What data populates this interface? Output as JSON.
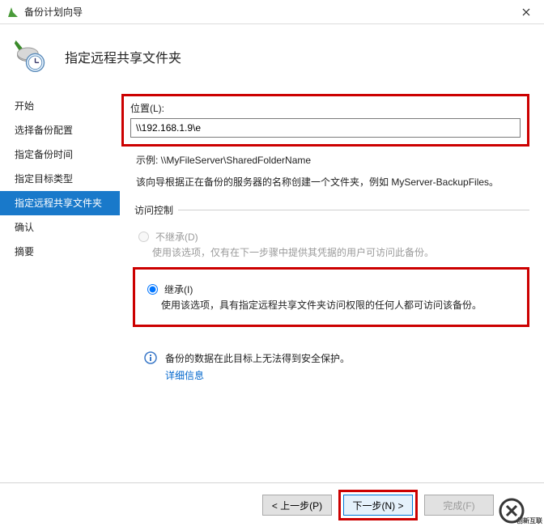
{
  "window": {
    "title": "备份计划向导"
  },
  "header": {
    "title": "指定远程共享文件夹"
  },
  "sidebar": {
    "steps": [
      {
        "label": "开始"
      },
      {
        "label": "选择备份配置"
      },
      {
        "label": "指定备份时间"
      },
      {
        "label": "指定目标类型"
      },
      {
        "label": "指定远程共享文件夹"
      },
      {
        "label": "确认"
      },
      {
        "label": "摘要"
      }
    ]
  },
  "main": {
    "location_label": "位置(L):",
    "location_value": "\\\\192.168.1.9\\e",
    "example_text": "示例: \\\\MyFileServer\\SharedFolderName",
    "folder_note": "该向导根据正在备份的服务器的名称创建一个文件夹，例如 MyServer-BackupFiles。",
    "access_legend": "访问控制",
    "radio_no_inherit": {
      "label": "不继承(D)",
      "desc": "使用该选项，仅有在下一步骤中提供其凭据的用户可访问此备份。"
    },
    "radio_inherit": {
      "label": "继承(I)",
      "desc": "使用该选项，具有指定远程共享文件夹访问权限的任何人都可访问该备份。"
    },
    "info_text": "备份的数据在此目标上无法得到安全保护。",
    "info_link": "详细信息"
  },
  "footer": {
    "back": "< 上一步(P)",
    "next": "下一步(N) >",
    "finish": "完成(F)"
  },
  "watermark": {
    "text": "创新互联"
  }
}
